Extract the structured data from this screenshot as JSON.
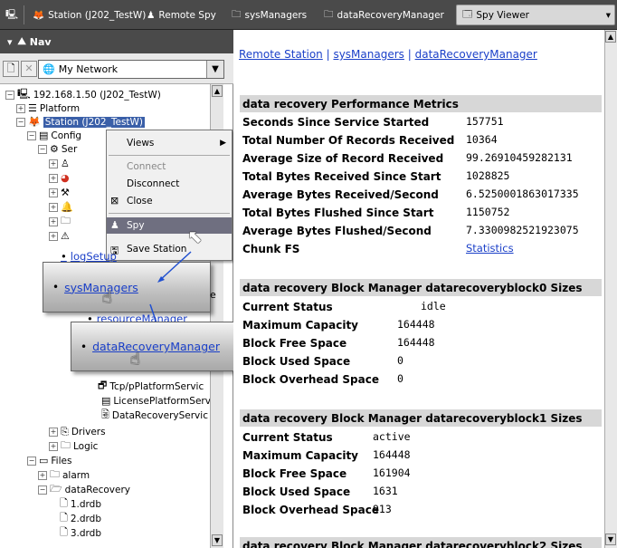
{
  "toolbar": {
    "items": [
      {
        "label": "Station (J202_TestW)"
      },
      {
        "label": "Remote Spy"
      },
      {
        "label": "sysManagers"
      },
      {
        "label": "dataRecoveryManager"
      }
    ],
    "active_tab": "Spy Viewer"
  },
  "nav": {
    "title": "Nav",
    "network_select": "My Network",
    "tree": [
      {
        "label": "192.168.1.50 (J202_TestW)"
      },
      {
        "label": "Platform"
      },
      {
        "label": "Station (J202_TestW)"
      },
      {
        "label": "Config"
      },
      {
        "label": "Ser"
      },
      {
        "label": "Tcp/pPlatformServic"
      },
      {
        "label": "LicensePlatformServ"
      },
      {
        "label": "DataRecoveryServic"
      },
      {
        "label": "Drivers"
      },
      {
        "label": "Logic"
      },
      {
        "label": "Files"
      },
      {
        "label": "alarm"
      },
      {
        "label": "dataRecovery"
      },
      {
        "label": "1.drdb"
      },
      {
        "label": "2.drdb"
      },
      {
        "label": "3.drdb"
      }
    ]
  },
  "context_menu": {
    "items": [
      "Views",
      "Connect",
      "Disconnect",
      "Close",
      "Spy",
      "Save Station"
    ]
  },
  "callouts": {
    "log_setup": "logSetup",
    "sys_managers": "sysManagers",
    "resource_manager": "resourceManager",
    "data_recovery_manager": "dataRecoveryManager",
    "tail_e": "e"
  },
  "main": {
    "breadcrumb": [
      "Remote Station",
      "sysManagers",
      "dataRecoveryManager"
    ],
    "breadcrumb_sep": " | ",
    "perf": {
      "title": "data recovery Performance Metrics",
      "rows": [
        {
          "k": "Seconds Since Service Started",
          "v": "157751"
        },
        {
          "k": "Total Number Of Records Received",
          "v": "10364"
        },
        {
          "k": "Average Size of Record Received",
          "v": "99.26910459282131"
        },
        {
          "k": "Total Bytes Received Since Start",
          "v": "1028825"
        },
        {
          "k": "Average Bytes Received/Second",
          "v": "6.5250001863017335"
        },
        {
          "k": "Total Bytes Flushed Since Start",
          "v": "1150752"
        },
        {
          "k": "Average Bytes Flushed/Second",
          "v": "7.3300982521923075"
        },
        {
          "k": "Chunk FS",
          "v": "Statistics"
        }
      ]
    },
    "block0": {
      "title": "data recovery Block Manager datarecoveryblock0 Sizes",
      "rows": [
        {
          "k": "Current Status",
          "v": "idle"
        },
        {
          "k": "Maximum Capacity",
          "v": "164448"
        },
        {
          "k": "Block Free Space",
          "v": "164448"
        },
        {
          "k": "Block Used Space",
          "v": "0"
        },
        {
          "k": "Block Overhead Space",
          "v": "0"
        }
      ]
    },
    "block1": {
      "title": "data recovery Block Manager datarecoveryblock1 Sizes",
      "rows": [
        {
          "k": "Current Status",
          "v": "active"
        },
        {
          "k": "Maximum Capacity",
          "v": "164448"
        },
        {
          "k": "Block Free Space",
          "v": "161904"
        },
        {
          "k": "Block Used Space",
          "v": "1631"
        },
        {
          "k": "Block Overhead Space",
          "v": "913"
        }
      ]
    },
    "block2_title": "data recovery Block Manager datarecoveryblock2 Sizes"
  }
}
